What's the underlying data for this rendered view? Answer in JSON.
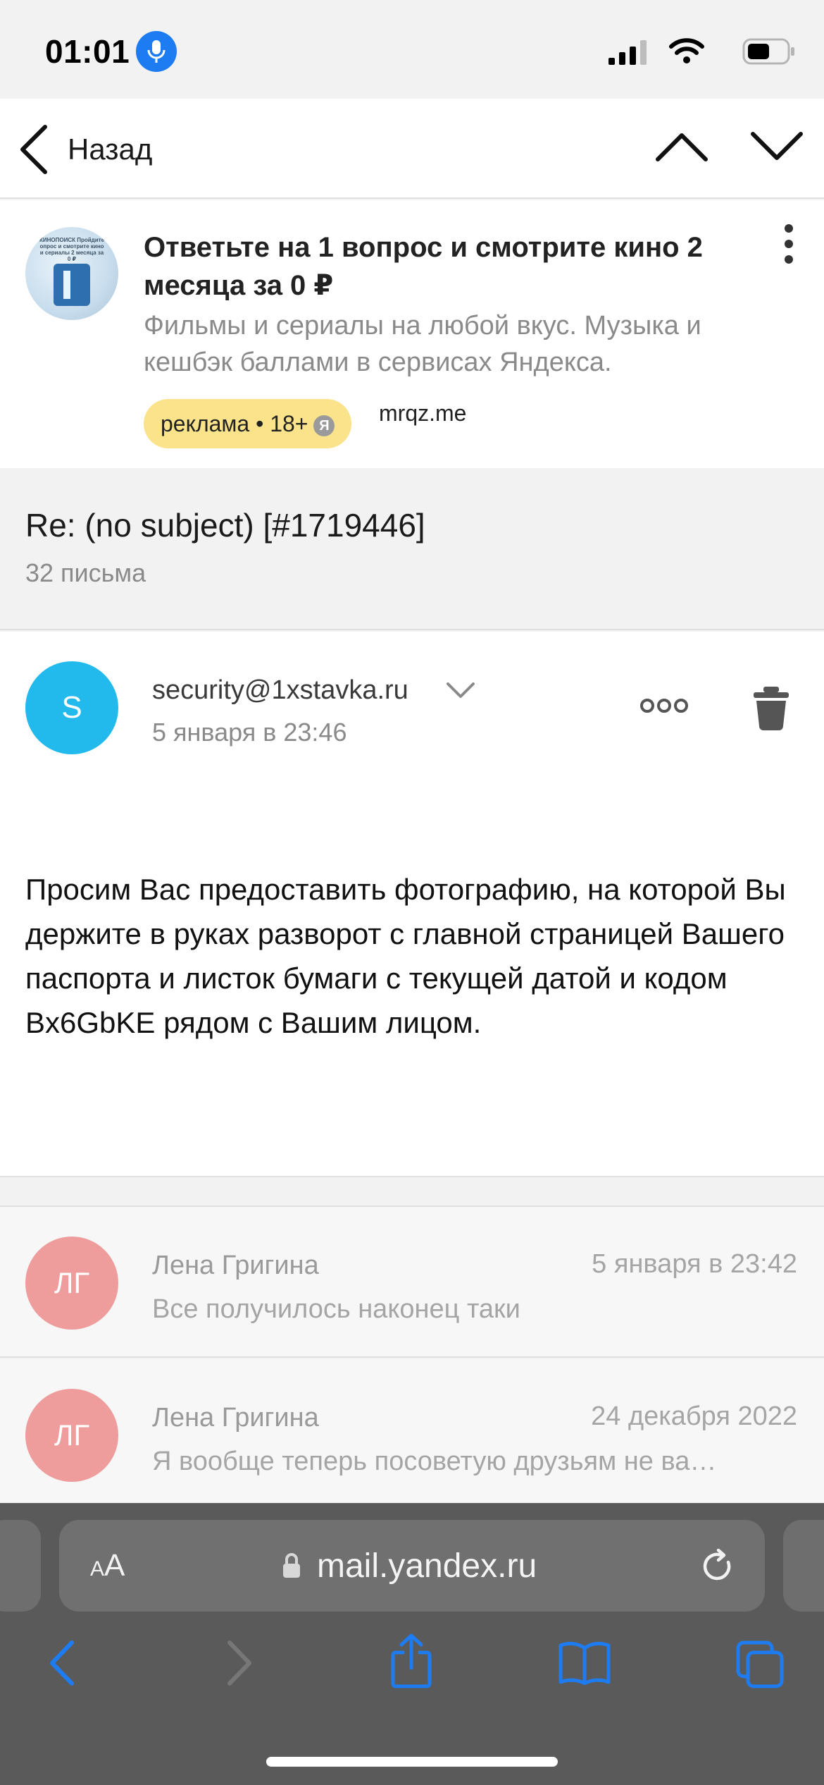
{
  "status_bar": {
    "time": "01:01",
    "icons": [
      "microphone-icon",
      "signal-icon",
      "wifi-icon",
      "battery-icon"
    ]
  },
  "nav": {
    "back_label": "Назад",
    "icons": [
      "chevron-left-icon",
      "chevron-up-icon",
      "chevron-down-icon"
    ]
  },
  "ad": {
    "title": "Ответьте на 1 вопрос и смотрите кино 2 месяца за 0 ₽",
    "description": "Фильмы и сериалы на любой вкус. Музыка и кешбэк баллами в сервисах Яндекса.",
    "badge": "реклама • 18+",
    "badge_logo": "Я",
    "domain": "mrqz.me",
    "thumb_text": "КИНОПОИСК Пройдите опрос и смотрите кино и сериалы 2 месяца за 0 ₽"
  },
  "thread": {
    "subject": "Re: (no subject) [#1719446]",
    "count": "32 письма"
  },
  "open_message": {
    "avatar_letter": "S",
    "sender": "security@1xstavka.ru",
    "date": "5 января в 23:46",
    "body": "Просим Вас предоставить фотографию, на которой Вы держите в руках разворот с главной страницей Вашего паспорта и листок бумаги с текущей датой и кодом Bx6GbKE рядом с Вашим лицом."
  },
  "messages": [
    {
      "avatar": "ЛГ",
      "name": "Лена Григина",
      "date": "5 января в 23:42",
      "preview": "Все получилось наконец таки"
    },
    {
      "avatar": "ЛГ",
      "name": "Лена Григина",
      "date": "24 декабря 2022",
      "preview": "Я вообще теперь посоветую друзьям не ва…"
    }
  ],
  "browser": {
    "aa_small": "A",
    "aa_large": "A",
    "url": "mail.yandex.ru"
  },
  "colors": {
    "accent_blue": "#1e7cf2",
    "avatar_s": "#22b9ec",
    "avatar_lg": "#ee9c9c",
    "ad_badge": "#fbe38c",
    "safari_bar": "#5a5a5a"
  }
}
